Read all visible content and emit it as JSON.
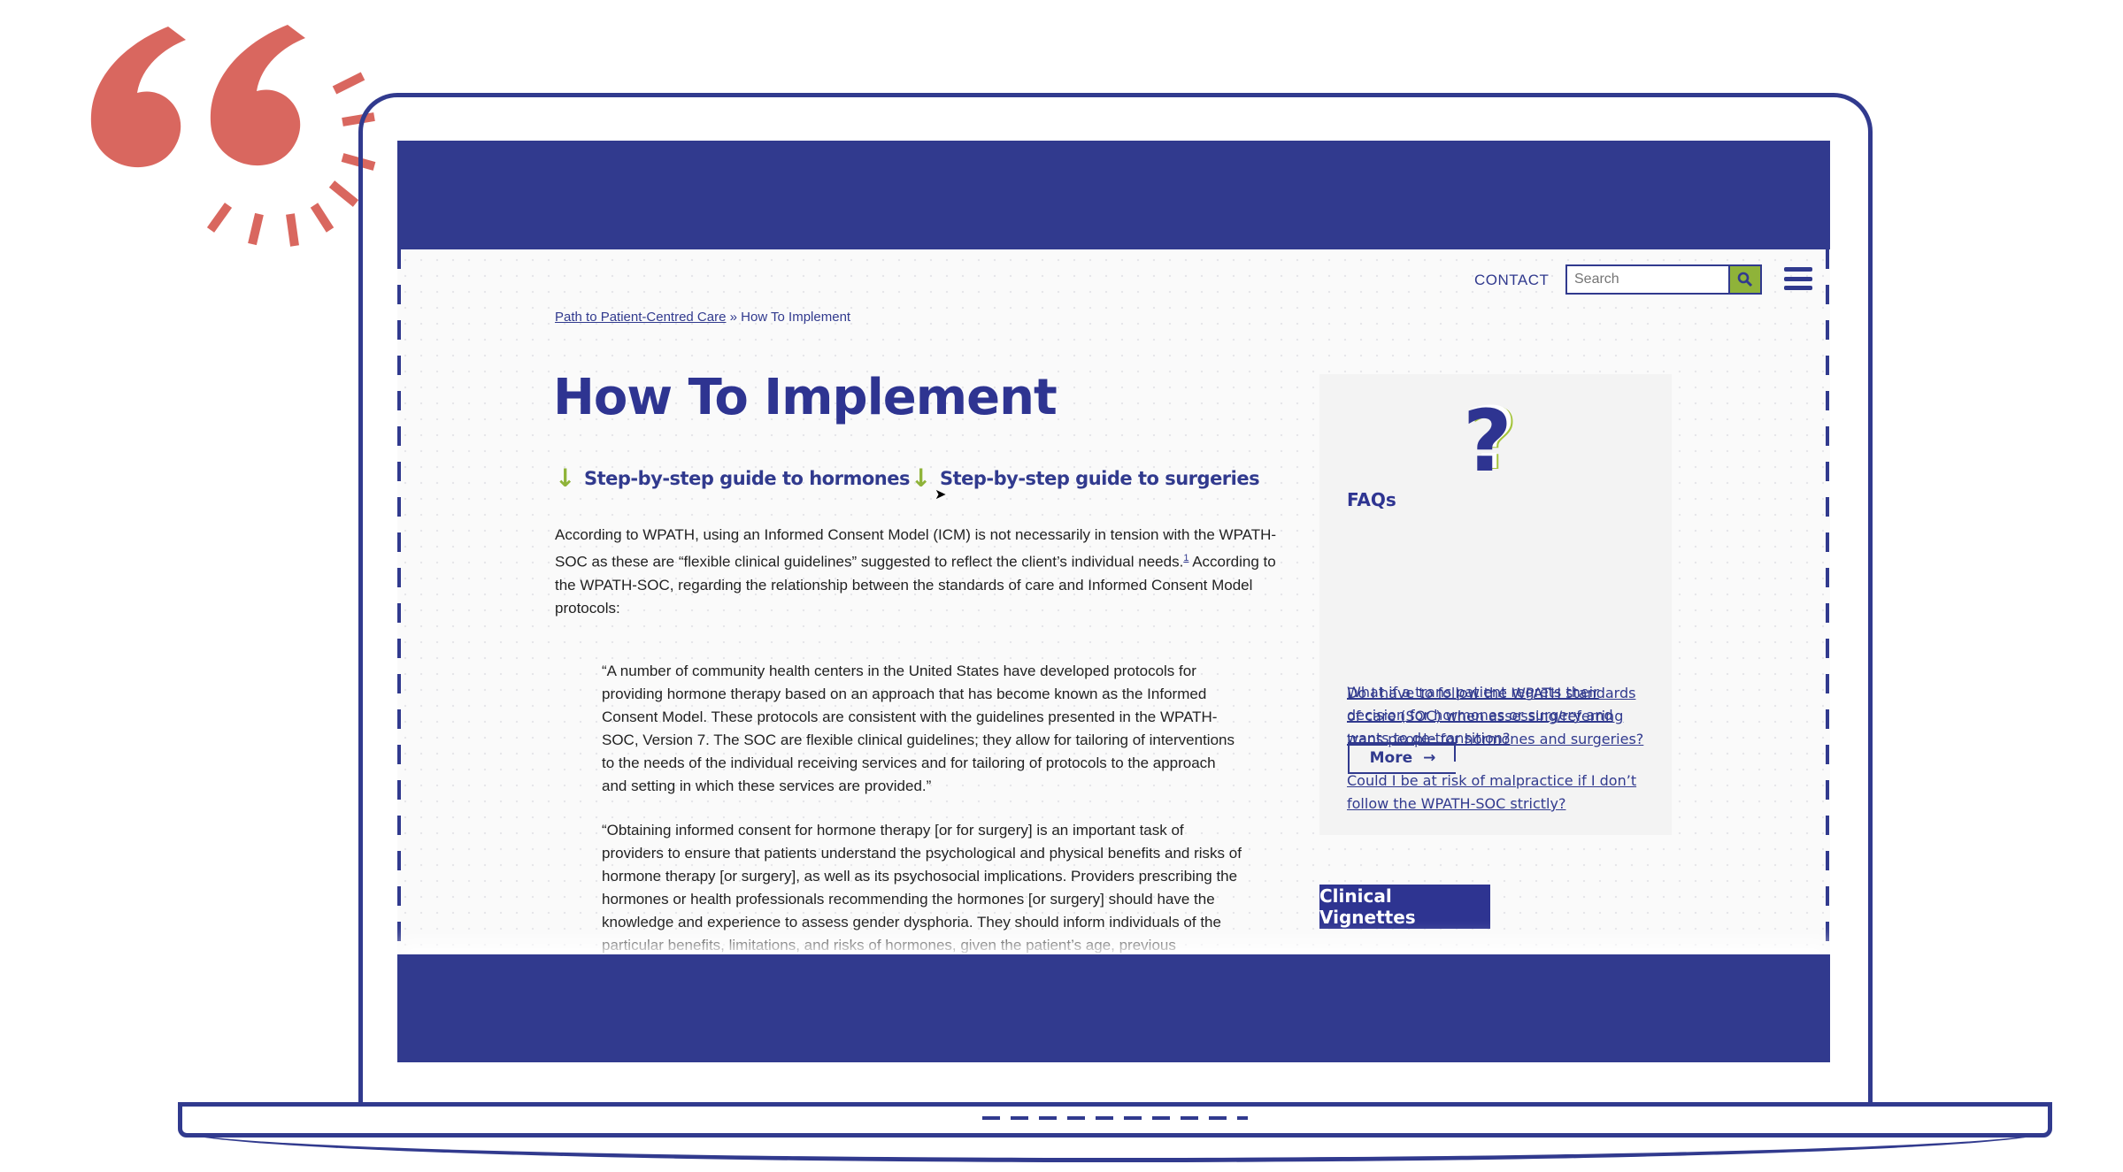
{
  "header": {
    "contact_label": "CONTACT",
    "search_placeholder": "Search",
    "search_icon": "magnifier-icon",
    "menu_icon": "hamburger-icon"
  },
  "breadcrumb": {
    "parent": "Path to Patient-Centred Care",
    "separator": "»",
    "current": "How To Implement"
  },
  "main": {
    "title": "How To Implement",
    "steps": [
      {
        "label": "Step-by-step guide to hormones",
        "icon": "arrow-down-icon"
      },
      {
        "label": "Step-by-step guide to surgeries",
        "icon": "arrow-down-icon"
      }
    ],
    "intro_a": "According to WPATH, using an Informed Consent Model (ICM) is not necessarily in tension with the WPATH-SOC as these are “flexible clinical guidelines” suggested to reflect the client’s individual needs.",
    "footnote": "1",
    "intro_b": " According to the WPATH-SOC, regarding the relationship between the standards of care and Informed Consent Model protocols:",
    "quote1": "“A number of community health centers in the United States have developed protocols for providing hormone therapy based on an approach that has become known as the Informed Consent Model. These protocols are consistent with the guidelines presented in the WPATH-SOC, Version 7. The SOC are flexible clinical guidelines; they allow for tailoring of interventions to the needs of the individual receiving services and for tailoring of protocols to the approach and setting in which these services are provided.”",
    "quote2": "“Obtaining informed consent for hormone therapy [or for surgery] is an important task of providers to ensure that patients understand the psychological and physical benefits and risks of hormone therapy [or surgery], as well as its psychosocial implications. Providers prescribing the hormones or health professionals recommending the hormones [or surgery] should have the knowledge and experience to assess gender dysphoria. They should inform individuals of the particular benefits, limitations, and risks of hormones, given the patient’s age, previous"
  },
  "sidebar": {
    "heading": "FAQs",
    "faqs": [
      "Do I have to follow the WPATH standards of care (SOC) when assessing/referring trans people for hormones and surgeries?",
      "Could I be at risk of malpractice if I don’t follow the WPATH-SOC strictly?",
      "What if a trans patient regrets their decision for hormones or surgery and wants to de-transition?"
    ],
    "more_label": "More",
    "clinical_vignettes_label": "Clinical Vignettes"
  },
  "colors": {
    "brand_blue": "#313a8e",
    "accent_green": "#8fb339",
    "quote_coral": "#d9675f"
  }
}
